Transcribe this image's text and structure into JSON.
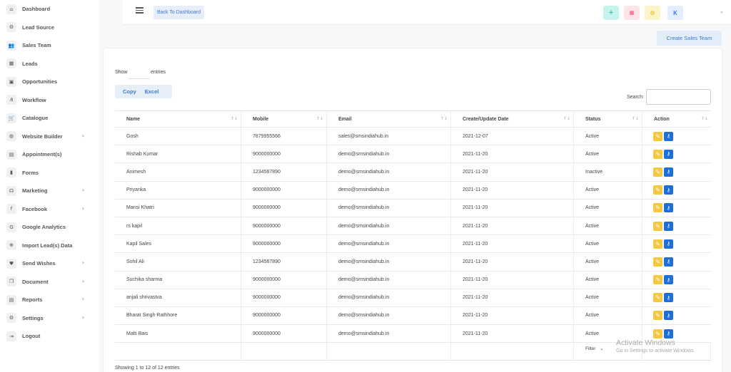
{
  "sidebar": {
    "items": [
      {
        "label": "Dashboard",
        "icon": "home-icon",
        "glyph": "⌂",
        "chevron": ""
      },
      {
        "label": "Lead Source",
        "icon": "cogs-icon",
        "glyph": "⚙",
        "chevron": ""
      },
      {
        "label": "Sales Team",
        "icon": "users-icon",
        "glyph": "👥",
        "chevron": ""
      },
      {
        "label": "Leads",
        "icon": "table-icon",
        "glyph": "▦",
        "chevron": ""
      },
      {
        "label": "Opportunities",
        "icon": "money-icon",
        "glyph": "▣",
        "chevron": ""
      },
      {
        "label": "Workflow",
        "icon": "sitemap-icon",
        "glyph": "⋔",
        "chevron": ""
      },
      {
        "label": "Catalogue",
        "icon": "cart-icon",
        "glyph": "🛒",
        "chevron": ""
      },
      {
        "label": "Website Builder",
        "icon": "globe-icon",
        "glyph": "◍",
        "chevron": "›"
      },
      {
        "label": "Appointment(s)",
        "icon": "calendar-icon",
        "glyph": "▤",
        "chevron": ""
      },
      {
        "label": "Forms",
        "icon": "file-icon",
        "glyph": "▮",
        "chevron": ""
      },
      {
        "label": "Marketing",
        "icon": "headset-icon",
        "glyph": "☊",
        "chevron": "›"
      },
      {
        "label": "Facebook",
        "icon": "facebook-icon",
        "glyph": "f",
        "chevron": "›"
      },
      {
        "label": "Google Analytics",
        "icon": "google-icon",
        "glyph": "G",
        "chevron": ""
      },
      {
        "label": "Import Lead(s) Data",
        "icon": "import-icon",
        "glyph": "⊕",
        "chevron": ""
      },
      {
        "label": "Send Wishes",
        "icon": "heart-icon",
        "glyph": "♥",
        "chevron": "›"
      },
      {
        "label": "Document",
        "icon": "copy-icon",
        "glyph": "❐",
        "chevron": "›"
      },
      {
        "label": "Reports",
        "icon": "report-icon",
        "glyph": "▤",
        "chevron": "›"
      },
      {
        "label": "Settings",
        "icon": "settings-icon",
        "glyph": "⚙",
        "chevron": "›"
      },
      {
        "label": "Logout",
        "icon": "logout-icon",
        "glyph": "⇥",
        "chevron": ""
      }
    ]
  },
  "topbar": {
    "back_label": "Back To Dashboard",
    "plus_glyph": "+",
    "grid_glyph": "▦",
    "gear_glyph": "⚙",
    "user_initial": "K",
    "chevron": "⌄"
  },
  "create_button": "Create Sales Team",
  "controls": {
    "show_label": "Show",
    "entries_label": "entries",
    "copy_label": "Copy",
    "excel_label": "Excel",
    "search_label": "Search:"
  },
  "table": {
    "headers": [
      "Name",
      "Mobile",
      "Email",
      "Create/Update Date",
      "Status",
      "Action"
    ],
    "rows": [
      [
        "Gosh",
        "7879955566",
        "sales@smsindiahub.in",
        "2021-12-07",
        "Active"
      ],
      [
        "Rishab Kumar",
        "9000000000",
        "demo@smsindiahub.in",
        "2021-11-20",
        "Active"
      ],
      [
        "Animesh",
        "1234567890",
        "demo@smsindiahub.in",
        "2021-11-20",
        "Inactive"
      ],
      [
        "Priyanka",
        "9000000000",
        "demo@smsindiahub.in",
        "2021-11-20",
        "Active"
      ],
      [
        "Mansi Khatri",
        "9000000000",
        "demo@smsindiahub.in",
        "2021-11-20",
        "Active"
      ],
      [
        "rs kapil",
        "9000000000",
        "demo@smsindiahub.in",
        "2021-11-20",
        "Active"
      ],
      [
        "Kapil Sales",
        "9000000000",
        "demo@smsindiahub.in",
        "2021-11-20",
        "Active"
      ],
      [
        "Sohil Ali",
        "1234567890",
        "demo@smsindiahub.in",
        "2021-11-20",
        "Active"
      ],
      [
        "Suchika sharma",
        "9000000000",
        "demo@smsindiahub.in",
        "2021-11-20",
        "Active"
      ],
      [
        "anjali shrivastva",
        "9000000000",
        "demo@smsindiahub.in",
        "2021-11-20",
        "Active"
      ],
      [
        "Bharat Singh Rathhore",
        "9000000000",
        "demo@smsindiahub.in",
        "2021-11-20",
        "Active"
      ],
      [
        "Malti Bais",
        "9000000000",
        "demo@smsindiahub.in",
        "2021-11-20",
        "Active"
      ]
    ],
    "edit_glyph": "✎",
    "key_glyph": "⚷",
    "sort_glyph": "↑↓",
    "filter_label": "Filter",
    "filter_chevron": "⌄"
  },
  "showing_text": "Showing 1 to 12 of 12 entries",
  "watermark": {
    "line1": "Activate Windows",
    "line2": "Go to Settings to activate Windows."
  }
}
